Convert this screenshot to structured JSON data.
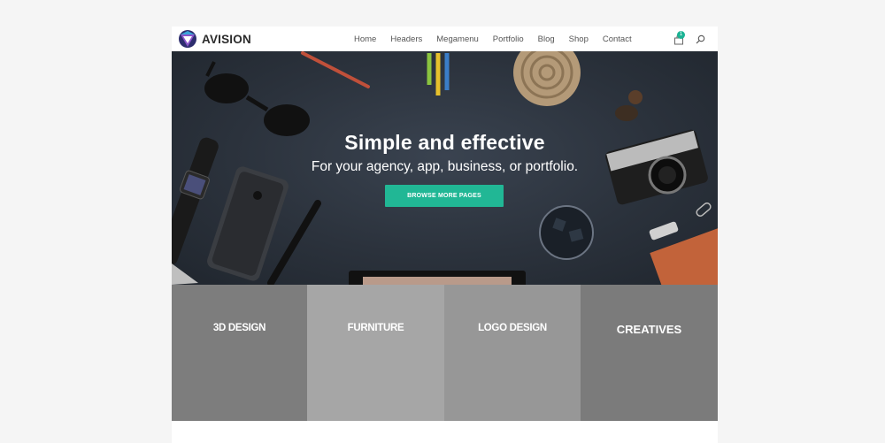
{
  "brand": {
    "name": "AVISION"
  },
  "nav": {
    "items": [
      "Home",
      "Headers",
      "Megamenu",
      "Portfolio",
      "Blog",
      "Shop",
      "Contact"
    ]
  },
  "cart": {
    "count": "1"
  },
  "hero": {
    "title": "Simple and effective",
    "subtitle": "For your agency, app, business, or portfolio.",
    "button_label": "BROWSE MORE PAGES"
  },
  "categories": [
    "3D DESIGN",
    "FURNITURE",
    "LOGO DESIGN",
    "CREATIVES"
  ],
  "colors": {
    "accent": "#21b795",
    "hero_bg": "#2b323c",
    "tile_1": "#7d7d7d",
    "tile_2": "#a6a6a6",
    "tile_3": "#979797",
    "tile_4": "#7b7b7b"
  }
}
